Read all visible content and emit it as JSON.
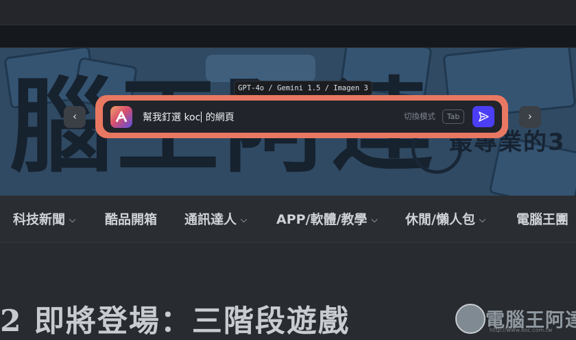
{
  "banner": {
    "title": "腦王阿達",
    "subtitle": "最專業的3"
  },
  "nav": {
    "items": [
      {
        "label": "科技新聞",
        "has_dropdown": true
      },
      {
        "label": "酷品開箱",
        "has_dropdown": false
      },
      {
        "label": "通訊達人",
        "has_dropdown": true
      },
      {
        "label": "APP/軟體/教學",
        "has_dropdown": true
      },
      {
        "label": "休閒/懶人包",
        "has_dropdown": true
      },
      {
        "label": "電腦王團",
        "has_dropdown": false
      }
    ],
    "chevron": "⌵"
  },
  "article": {
    "title_fragment": "2 即將登場：三階段遊戲"
  },
  "watermark": {
    "text": "電腦王阿達",
    "url": "http://www.koc.com.tw"
  },
  "assistant": {
    "model_tooltip": "GPT-4o / Gemini 1.5 / Imagen 3",
    "prompt_before_caret": "幫我釘選 koc",
    "prompt_after_caret": " 的網頁",
    "mode_label": "切換模式",
    "tab_key": "Tab",
    "prev_arrow": "‹",
    "next_arrow": "›",
    "logo_icon": "arc-logo-icon",
    "send_icon": "send-icon",
    "accent": "#e97862",
    "send_color": "#4b3ef5"
  }
}
